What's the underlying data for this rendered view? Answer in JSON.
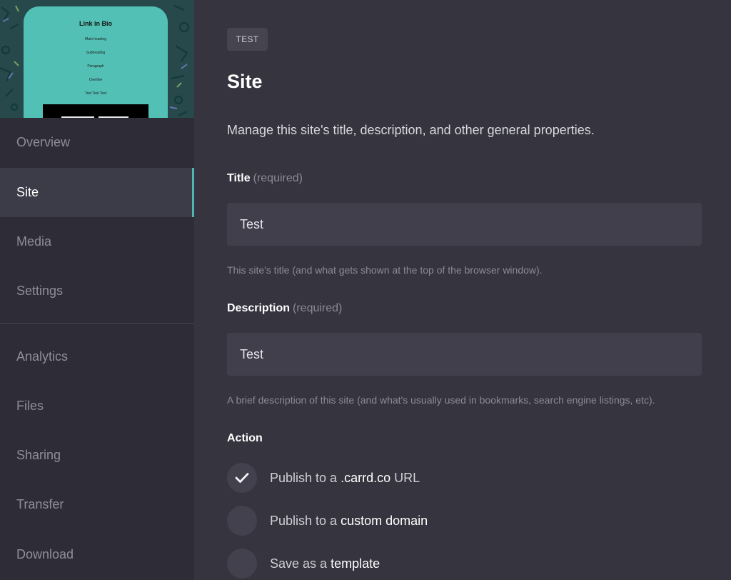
{
  "preview": {
    "title": "Link in Bio",
    "lines": [
      "Main heading",
      "Subheading",
      "Paragraph",
      "Overline",
      "Test Test Test"
    ]
  },
  "nav": {
    "top": [
      "Overview",
      "Site",
      "Media",
      "Settings"
    ],
    "bottom": [
      "Analytics",
      "Files",
      "Sharing",
      "Transfer",
      "Download"
    ],
    "active": "Site"
  },
  "main": {
    "badge": "TEST",
    "title": "Site",
    "description": "Manage this site's title, description, and other general properties.",
    "fields": {
      "title": {
        "label": "Title",
        "required": "(required)",
        "value": "Test",
        "help": "This site's title (and what gets shown at the top of the browser window)."
      },
      "description": {
        "label": "Description",
        "required": "(required)",
        "value": "Test",
        "help": "A brief description of this site (and what's usually used in bookmarks, search engine listings, etc)."
      }
    },
    "action": {
      "label": "Action",
      "options": [
        {
          "prefix": "Publish to a ",
          "emphasis": ".carrd.co",
          "suffix": " URL",
          "checked": true
        },
        {
          "prefix": "Publish to a ",
          "emphasis": "custom domain",
          "suffix": "",
          "checked": false
        },
        {
          "prefix": "Save as a ",
          "emphasis": "template",
          "suffix": "",
          "checked": false
        }
      ]
    }
  },
  "colors": {
    "background": "#35343f",
    "sidebar": "#2e2d37",
    "accent": "#4fb7ae",
    "preview_card": "#53c0b6"
  },
  "icons": {
    "check": "check-icon"
  }
}
